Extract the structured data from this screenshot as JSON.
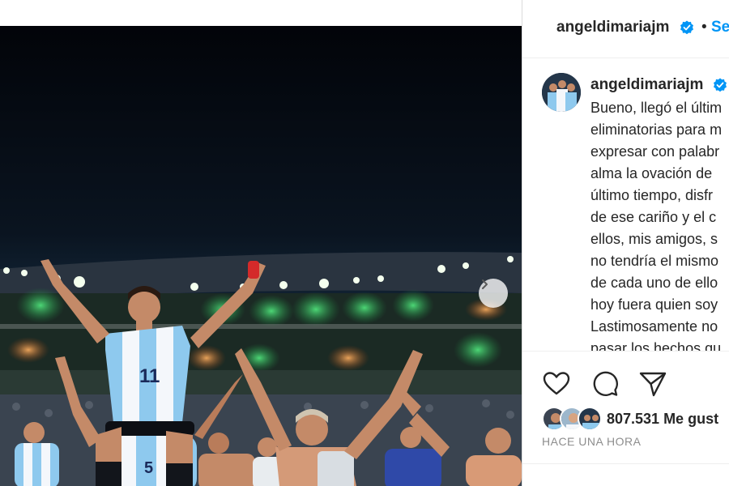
{
  "header": {
    "username": "angeldimariajm",
    "separator": "•",
    "follow_label": "Se"
  },
  "caption": {
    "username": "angeldimariajm",
    "lines": [
      "Bueno, llegó el últim",
      "eliminatorias para m",
      "expresar con palabr",
      "alma la ovación de",
      "último tiempo, disfr",
      "de ese cariño y el c",
      "ellos, mis amigos, s",
      "no tendría el mismo",
      "de cada uno de ello",
      "hoy fuera quien soy",
      "Lastimosamente no",
      "pasar los hechos qu"
    ]
  },
  "actions": {
    "like_icon": "heart-icon",
    "comment_icon": "comment-icon",
    "share_icon": "send-icon"
  },
  "likes": {
    "text": "807.531 Me gust"
  },
  "time_ago": "HACE UNA HORA",
  "media": {
    "jersey_number_main": "11",
    "jersey_number_second": "5",
    "next_icon": "chevron-right-icon"
  },
  "colors": {
    "link_blue": "#0095f6",
    "verified_blue": "#0095f6",
    "stadium_green": "#2bbf57",
    "jersey_sky": "#8ec9ee"
  }
}
